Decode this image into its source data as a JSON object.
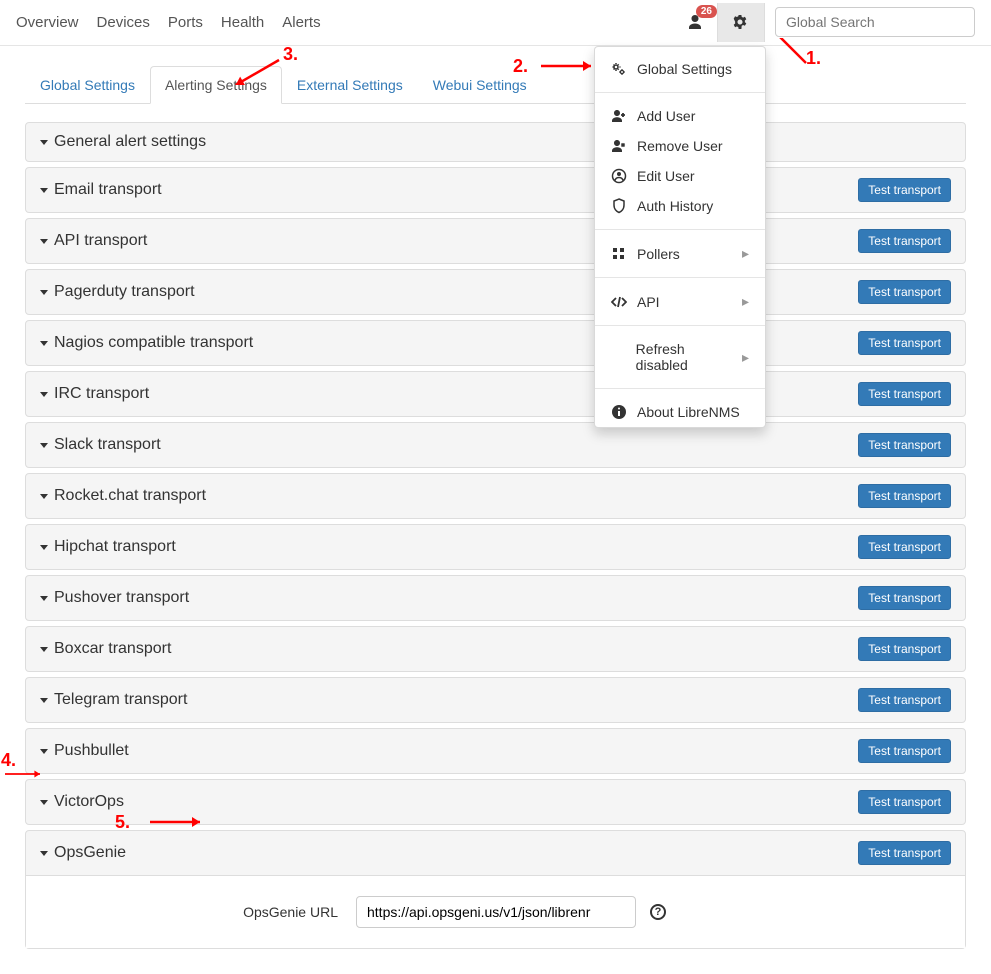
{
  "navbar": {
    "items": [
      "Overview",
      "Devices",
      "Ports",
      "Health",
      "Alerts"
    ],
    "notification_count": "26",
    "search_placeholder": "Global Search"
  },
  "dropdown": {
    "items": [
      {
        "icon": "gears",
        "label": "Global Settings"
      },
      {
        "divider": true
      },
      {
        "icon": "user-plus",
        "label": "Add User"
      },
      {
        "icon": "user-times",
        "label": "Remove User"
      },
      {
        "icon": "user-circle",
        "label": "Edit User"
      },
      {
        "icon": "shield",
        "label": "Auth History"
      },
      {
        "divider": true
      },
      {
        "icon": "grid",
        "label": "Pollers",
        "submenu": true
      },
      {
        "divider": true
      },
      {
        "icon": "code",
        "label": "API",
        "submenu": true
      },
      {
        "divider": true
      },
      {
        "icon": "none",
        "label": "Refresh disabled",
        "submenu": true
      },
      {
        "divider": true
      },
      {
        "icon": "info",
        "label": "About LibreNMS"
      }
    ]
  },
  "tabs": [
    "Global Settings",
    "Alerting Settings",
    "External Settings",
    "Webui Settings"
  ],
  "active_tab": 1,
  "panels": [
    {
      "title": "General alert settings",
      "test": false
    },
    {
      "title": "Email transport",
      "test": true
    },
    {
      "title": "API transport",
      "test": true
    },
    {
      "title": "Pagerduty transport",
      "test": true
    },
    {
      "title": "Nagios compatible transport",
      "test": true
    },
    {
      "title": "IRC transport",
      "test": true
    },
    {
      "title": "Slack transport",
      "test": true
    },
    {
      "title": "Rocket.chat transport",
      "test": true
    },
    {
      "title": "Hipchat transport",
      "test": true
    },
    {
      "title": "Pushover transport",
      "test": true
    },
    {
      "title": "Boxcar transport",
      "test": true
    },
    {
      "title": "Telegram transport",
      "test": true
    },
    {
      "title": "Pushbullet",
      "test": true
    },
    {
      "title": "VictorOps",
      "test": true
    },
    {
      "title": "OpsGenie",
      "test": true,
      "open": true
    }
  ],
  "test_button_label": "Test transport",
  "opsgenie": {
    "label": "OpsGenie URL",
    "value": "https://api.opsgeni.us/v1/json/librenr"
  },
  "annotations": {
    "a1": "1.",
    "a2": "2.",
    "a3": "3.",
    "a4": "4.",
    "a5": "5."
  }
}
